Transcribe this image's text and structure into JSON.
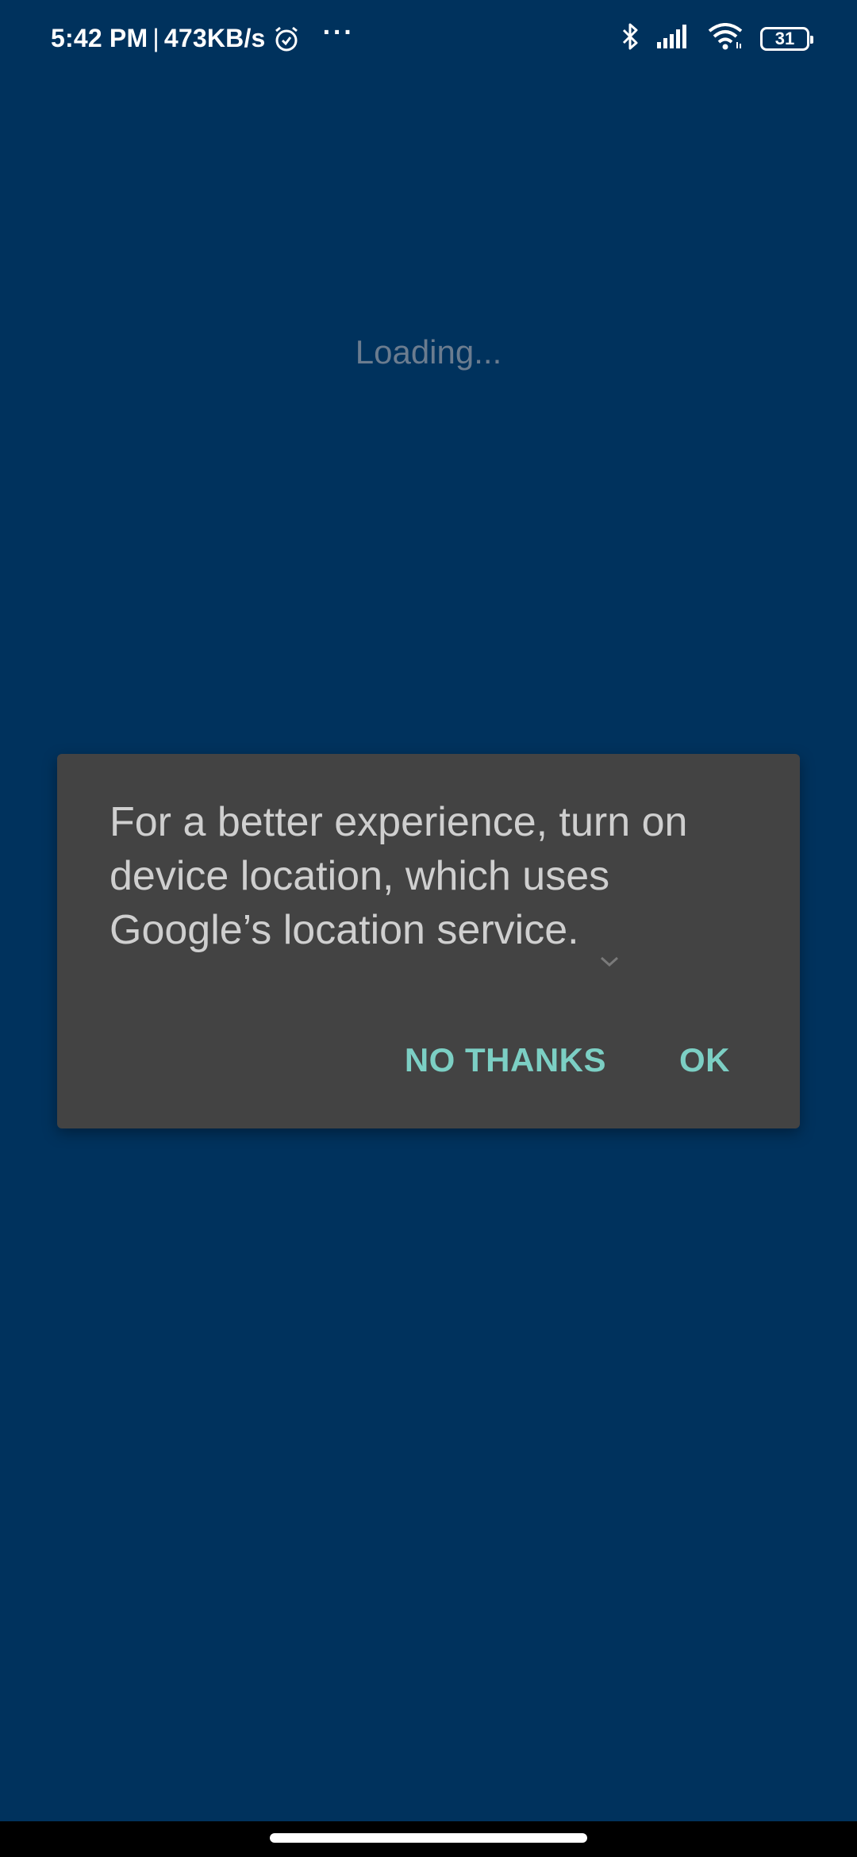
{
  "status_bar": {
    "time": "5:42 PM",
    "separator": "|",
    "network_speed": "473KB/s",
    "more_indicator": "···",
    "battery_level": "31",
    "icons": [
      "alarm-icon",
      "more-icon",
      "bluetooth-icon",
      "signal-icon",
      "wifi-icon",
      "battery-icon"
    ]
  },
  "main": {
    "loading_text": "Loading..."
  },
  "dialog": {
    "message": "For a better experience, turn on device location, which uses Google’s location service.",
    "negative_button": "NO THANKS",
    "positive_button": "OK"
  },
  "colors": {
    "background": "#00325d",
    "dialog_background": "#434343",
    "accent": "#7ccfc4",
    "loading_text": "#6b7c8f"
  }
}
